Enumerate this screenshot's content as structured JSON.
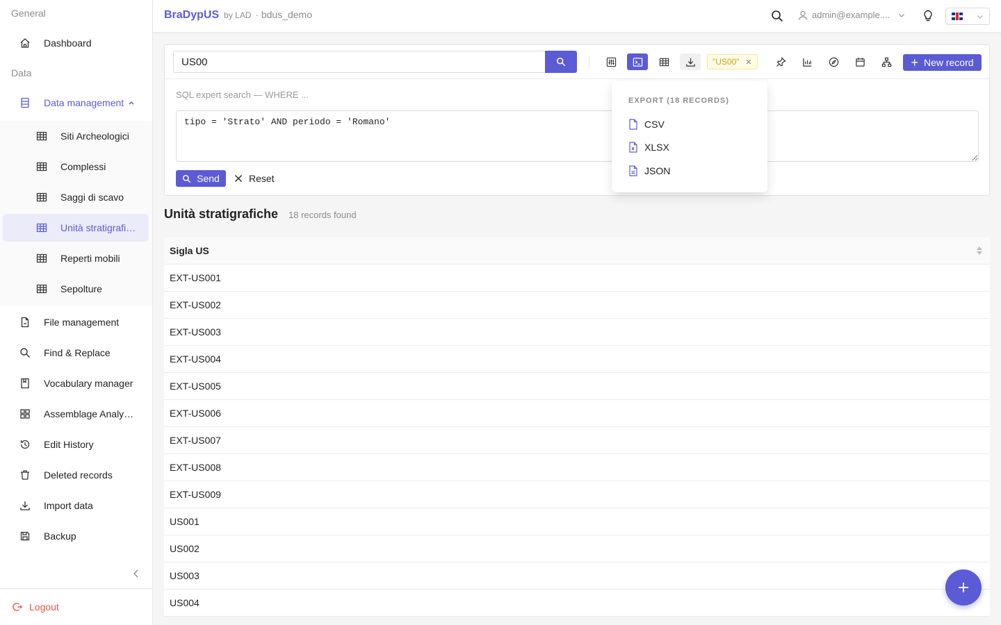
{
  "header": {
    "brand": "BraDypUS",
    "by": "by LAD",
    "separator": "·",
    "app_name": "bdus_demo",
    "user": "admin@example....",
    "icons": {
      "search": "search-icon",
      "user": "user-icon",
      "tips": "lightbulb-icon",
      "flag": "uk-flag-icon"
    }
  },
  "sidebar": {
    "group_general": "General",
    "group_data": "Data",
    "dashboard": "Dashboard",
    "data_management": "Data management",
    "sub_items": [
      {
        "label": "Siti Archeologici"
      },
      {
        "label": "Complessi"
      },
      {
        "label": "Saggi di scavo"
      },
      {
        "label": "Unità stratigrafiche"
      },
      {
        "label": "Reperti mobili"
      },
      {
        "label": "Sepolture"
      }
    ],
    "items": [
      {
        "label": "File management"
      },
      {
        "label": "Find & Replace"
      },
      {
        "label": "Vocabulary manager"
      },
      {
        "label": "Assemblage Analysis"
      },
      {
        "label": "Edit History"
      },
      {
        "label": "Deleted records"
      },
      {
        "label": "Import data"
      },
      {
        "label": "Backup"
      }
    ],
    "logout": "Logout"
  },
  "search": {
    "value": "US00",
    "tag": "\"US00\"",
    "new_record": "New record",
    "sql_label": "SQL expert search — WHERE ...",
    "sql_value": "tipo = 'Strato' AND periodo = 'Romano'",
    "send": "Send",
    "reset": "Reset"
  },
  "export_menu": {
    "title": "EXPORT (18 RECORDS)",
    "options": [
      "CSV",
      "XLSX",
      "JSON"
    ]
  },
  "results": {
    "title": "Unità stratigrafiche",
    "count": "18 records found",
    "column": "Sigla US",
    "rows": [
      "EXT-US001",
      "EXT-US002",
      "EXT-US003",
      "EXT-US004",
      "EXT-US005",
      "EXT-US006",
      "EXT-US007",
      "EXT-US008",
      "EXT-US009",
      "US001",
      "US002",
      "US003",
      "US004"
    ]
  },
  "colors": {
    "accent": "#5b5bd6",
    "danger": "#e5534b",
    "tag_text": "#d4a017"
  }
}
